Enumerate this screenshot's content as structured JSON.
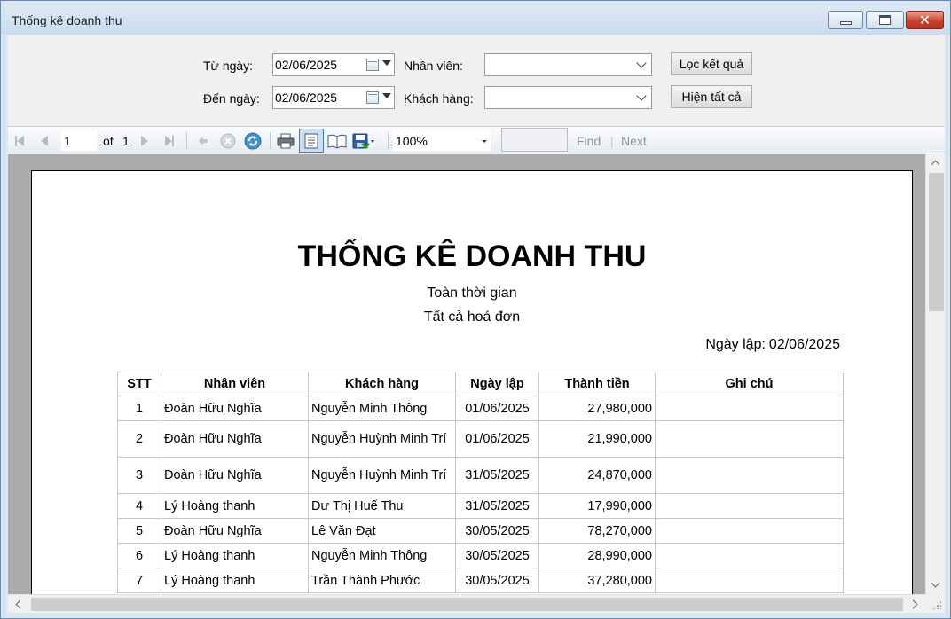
{
  "window": {
    "title": "Thống kê doanh thu"
  },
  "filters": {
    "from_label": "Từ ngày:",
    "from_value": "02/06/2025",
    "to_label": "Đến ngày:",
    "to_value": "02/06/2025",
    "employee_label": "Nhân viên:",
    "employee_value": "",
    "customer_label": "Khách hàng:",
    "customer_value": "",
    "filter_button": "Lọc kết quả",
    "show_all_button": "Hiện tất cả"
  },
  "toolbar": {
    "page_current": "1",
    "page_of": "of",
    "page_total": "1",
    "zoom": "100%",
    "find_value": "",
    "find_label": "Find",
    "find_sep": "|",
    "next_label": "Next"
  },
  "report": {
    "title": "THỐNG KÊ DOANH THU",
    "subtitle_time": "Toàn thời gian",
    "subtitle_scope": "Tất cả hoá đơn",
    "date_label": "Ngày lập:",
    "date_value": "02/06/2025",
    "columns": [
      "STT",
      "Nhân viên",
      "Khách hàng",
      "Ngày lập",
      "Thành tiền",
      "Ghi chú"
    ],
    "rows": [
      [
        "1",
        "Đoàn Hữu Nghĩa",
        "Nguyễn Minh Thông",
        "01/06/2025",
        "27,980,000",
        ""
      ],
      [
        "2",
        "Đoàn Hữu Nghĩa",
        "Nguyễn Huỳnh Minh Trí",
        "01/06/2025",
        "21,990,000",
        ""
      ],
      [
        "3",
        "Đoàn Hữu Nghĩa",
        "Nguyễn Huỳnh Minh Trí",
        "31/05/2025",
        "24,870,000",
        ""
      ],
      [
        "4",
        "Lý Hoàng thanh",
        "Dư Thị Huế Thu",
        "31/05/2025",
        "17,990,000",
        ""
      ],
      [
        "5",
        "Đoàn Hữu Nghĩa",
        "Lê Văn Đạt",
        "30/05/2025",
        "78,270,000",
        ""
      ],
      [
        "6",
        "Lý Hoàng thanh",
        "Nguyễn Minh Thông",
        "30/05/2025",
        "28,990,000",
        ""
      ],
      [
        "7",
        "Lý Hoàng thanh",
        "Trần Thành Phước",
        "30/05/2025",
        "37,280,000",
        ""
      ]
    ]
  },
  "icons": {
    "first_page": "first-page-icon",
    "prev_page": "previous-page-icon",
    "next_page": "next-page-icon",
    "last_page": "last-page-icon",
    "back": "back-icon",
    "stop": "stop-icon",
    "refresh": "refresh-icon",
    "print": "print-icon",
    "print_layout": "print-layout-icon",
    "page_setup": "page-setup-icon",
    "export": "export-icon"
  },
  "colors": {
    "titlebar": "#cbdcef",
    "close_button": "#c8432e",
    "report_background": "#ababab",
    "toolbar": "#e8edf3"
  }
}
